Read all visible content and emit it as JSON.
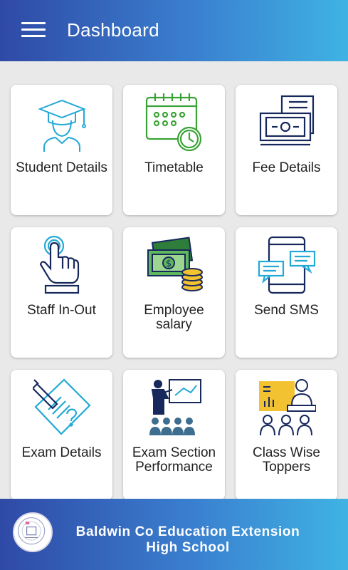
{
  "header": {
    "title": "Dashboard",
    "menu_icon": "hamburger-menu-icon"
  },
  "cards": [
    {
      "label": "Student Details",
      "icon": "graduate-student-icon"
    },
    {
      "label": "Timetable",
      "icon": "calendar-clock-icon"
    },
    {
      "label": "Fee Details",
      "icon": "money-bill-icon"
    },
    {
      "label": "Staff In-Out",
      "icon": "finger-tap-icon"
    },
    {
      "label": "Employee salary",
      "icon": "cash-coins-icon"
    },
    {
      "label": "Send SMS",
      "icon": "phone-message-icon"
    },
    {
      "label": "Exam Details",
      "icon": "exam-paper-pencil-icon"
    },
    {
      "label": "Exam Section Performance",
      "icon": "presentation-audience-icon"
    },
    {
      "label": "Class Wise Toppers",
      "icon": "teacher-class-icon"
    }
  ],
  "footer": {
    "school_name": "Baldwin Co Education Extension High School",
    "logo_icon": "school-seal-logo"
  },
  "colors": {
    "bar_start": "#2f4aa6",
    "bar_end": "#3fb3e3",
    "icon_cyan": "#22a9d6",
    "icon_green": "#3aa335",
    "icon_navy": "#17285c",
    "icon_yellow": "#f2c230"
  }
}
